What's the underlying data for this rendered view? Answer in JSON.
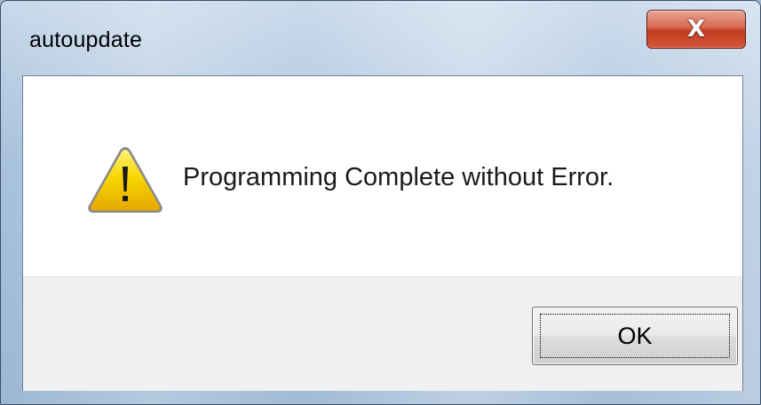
{
  "window": {
    "title": "autoupdate",
    "close_glyph": "X",
    "close_icon": "close-icon"
  },
  "dialog": {
    "icon": "warning-icon",
    "message": "Programming Complete without Error."
  },
  "buttons": {
    "ok_label": "OK"
  },
  "colors": {
    "close_button": "#c94a30",
    "warning_fill": "#f5d200",
    "footer_background": "#f0f0f0"
  }
}
